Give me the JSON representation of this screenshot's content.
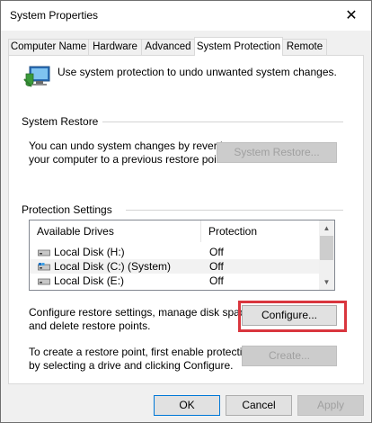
{
  "window": {
    "title": "System Properties",
    "close_glyph": "✕"
  },
  "tabs": [
    {
      "label": "Computer Name",
      "active": false
    },
    {
      "label": "Hardware",
      "active": false
    },
    {
      "label": "Advanced",
      "active": false
    },
    {
      "label": "System Protection",
      "active": true
    },
    {
      "label": "Remote",
      "active": false
    }
  ],
  "intro": {
    "text": "Use system protection to undo unwanted system changes.",
    "icon": "system-protection-icon"
  },
  "system_restore": {
    "group_label": "System Restore",
    "description_line1": "You can undo system changes by reverting",
    "description_line2": "your computer to a previous restore point.",
    "button_label": "System Restore...",
    "button_enabled": false
  },
  "protection_settings": {
    "group_label": "Protection Settings",
    "columns": [
      "Available Drives",
      "Protection"
    ],
    "rows": [
      {
        "drive": "Local Disk (H:)",
        "protection": "Off",
        "icon": "drive-icon",
        "selected": false
      },
      {
        "drive": "Local Disk (C:) (System)",
        "protection": "Off",
        "icon": "system-drive-icon",
        "selected": true
      },
      {
        "drive": "Local Disk (E:)",
        "protection": "Off",
        "icon": "drive-icon",
        "selected": false
      }
    ],
    "configure_text_line1": "Configure restore settings, manage disk space,",
    "configure_text_line2": "and delete restore points.",
    "configure_button": "Configure...",
    "create_text_line1": "To create a restore point, first enable protection",
    "create_text_line2": "by selecting a drive and clicking Configure.",
    "create_button": "Create..."
  },
  "footer": {
    "ok": "OK",
    "cancel": "Cancel",
    "apply": "Apply"
  },
  "colors": {
    "accent": "#0078d7",
    "highlight": "#d9363e",
    "disabled_text": "#a0a0a0"
  }
}
